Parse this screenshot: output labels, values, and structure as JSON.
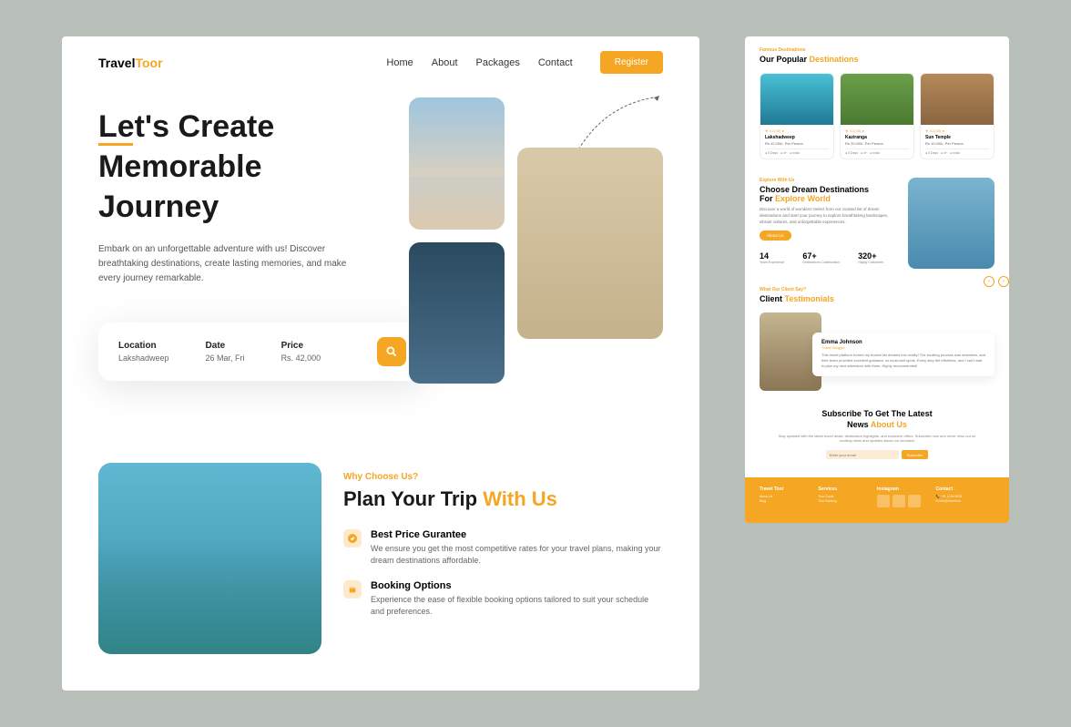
{
  "brand": {
    "pre": "Travel",
    "post": "Toor"
  },
  "nav": {
    "home": "Home",
    "about": "About",
    "packages": "Packages",
    "contact": "Contact",
    "register": "Register"
  },
  "hero": {
    "line1": "Let's",
    "line2": "Create",
    "line3": "Memorable",
    "line4": "Journey",
    "sub": "Embark on an unforgettable adventure with us! Discover breathtaking destinations, create lasting memories, and make every journey remarkable."
  },
  "search": {
    "loc_label": "Location",
    "loc_val": "Lakshadweep",
    "date_label": "Date",
    "date_val": "26 Mar, Fri",
    "price_label": "Price",
    "price_val": "Rs. 42,000"
  },
  "why": {
    "tag": "Why Choose Us?",
    "title_pre": "Plan Your Trip ",
    "title_acc": "With Us",
    "f1_title": "Best Price Gurantee",
    "f1_desc": "We ensure you get the most competitive rates for your travel plans, making your dream destinations affordable.",
    "f2_title": "Booking Options",
    "f2_desc": "Experience the ease of flexible booking options tailored to suit your schedule and preferences."
  },
  "popular": {
    "tag": "Famous Destinations",
    "title_pre": "Our Popular ",
    "title_acc": "Destinations",
    "cards": [
      {
        "rating": "★ 4.2(40) ●",
        "name": "Lakshadweep",
        "price": "Rs 42,000/- Per Person",
        "m1": "● 5 Days",
        "m2": "● 4+",
        "m3": "● India"
      },
      {
        "rating": "★ 4.2(40) ●",
        "name": "Kaziranga",
        "price": "Rs 20,000/- Per Person",
        "m1": "● 3 Days",
        "m2": "● 4+",
        "m3": "● India"
      },
      {
        "rating": "★ 4.2(40) ●",
        "name": "Sun Temple",
        "price": "Rs 10,000/- Per Person",
        "m1": "● 3 Days",
        "m2": "● 4+",
        "m3": "● India"
      }
    ]
  },
  "dream": {
    "tag": "Explore With Us",
    "title_l1": "Choose Dream Destinations",
    "title_l2_pre": "For ",
    "title_l2_acc": "Explore World",
    "desc": "Discover a world of wonders! Select from our curated list of dream destinations and start your journey to explore breathtaking landscapes, vibrant cultures, and unforgettable experiences.",
    "btn": "About Us",
    "stats": [
      {
        "num": "14",
        "lbl": "Years Experience"
      },
      {
        "num": "67+",
        "lbl": "Destinations Collaboration"
      },
      {
        "num": "320+",
        "lbl": "Happy Customers"
      }
    ]
  },
  "testi": {
    "tag": "What Our Client Say?",
    "title_pre": "Client ",
    "title_acc": "Testimonials",
    "name": "Emma Johnson",
    "role": "Travel Blogger",
    "text": "This travel platform turned my bucket list dreams into reality! The booking process was seamless, and their team provided excellent guidance on must-visit spots. Every step felt effortless, and I can't wait to plan my next adventure with them. Highly recommended!"
  },
  "sub": {
    "title_l1": "Subscribe To Get The Latest",
    "title_l2_pre": "News ",
    "title_l2_acc": "About Us",
    "desc": "Stay updated with the latest travel deals, destination highlights, and exclusive offers. Subscribe now and never miss out on exciting news and updates about our services!",
    "placeholder": "Enter your email",
    "btn": "Subscribe"
  },
  "footer": {
    "c1": "Travel Toor",
    "c2": "Services",
    "c3": "Instagram",
    "c4": "Contact",
    "i1": "About Us",
    "i2": "Blog",
    "s1": "Tour Guide",
    "s2": "Tour Booking",
    "ct1": "📞  +91 1234 5678",
    "ct2": "✉  info@traveltoor"
  }
}
